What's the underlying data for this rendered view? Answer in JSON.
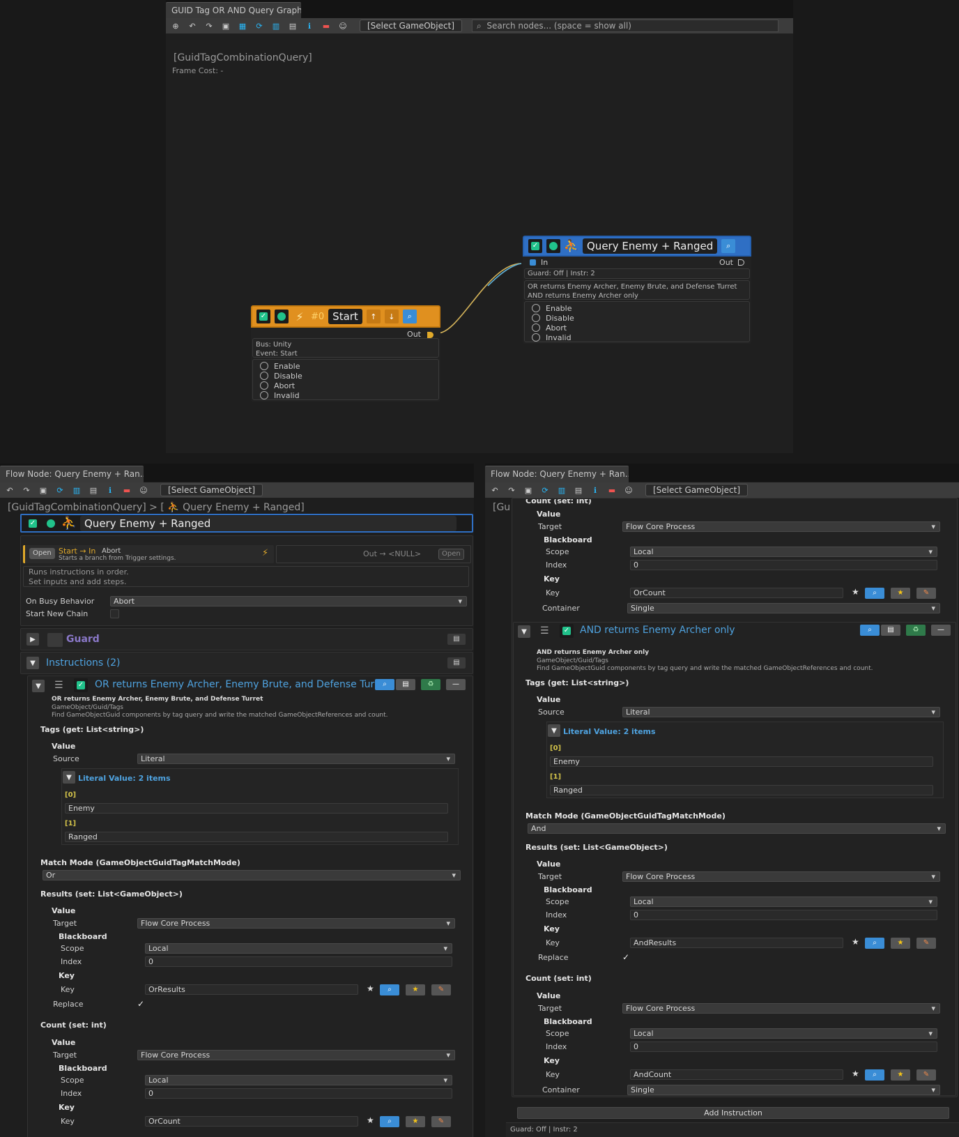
{
  "graph": {
    "tab_title": "GUID Tag OR AND Query Graph",
    "select_gameobject": "[Select GameObject]",
    "search_placeholder": "Search nodes... (space = show all)",
    "query_name": "[GuidTagCombinationQuery]",
    "frame_cost": "Frame Cost: -",
    "start_node": {
      "index": "#0",
      "title": "Start",
      "out_label": "Out",
      "bus": "Bus: Unity",
      "event": "Event: Start",
      "options": [
        "Enable",
        "Disable",
        "Abort",
        "Invalid"
      ]
    },
    "query_node": {
      "title": "Query Enemy + Ranged",
      "in_label": "In",
      "out_label": "Out",
      "guard_info": "Guard: Off | Instr: 2",
      "desc_line1": "OR returns Enemy Archer, Enemy Brute, and Defense Turret",
      "desc_line2": "AND returns Enemy Archer only",
      "options": [
        "Enable",
        "Disable",
        "Abort",
        "Invalid"
      ]
    },
    "colors": {
      "start_accent": "#e0901f",
      "query_accent": "#2f6fc4",
      "check": "#21c28b"
    }
  },
  "left_panel": {
    "tab_title": "Flow Node: Query Enemy + Ran...",
    "select_gameobject": "[Select GameObject]",
    "breadcrumb_root": "[GuidTagCombinationQuery]",
    "breadcrumb_sep": ">",
    "breadcrumb_node": "[ ⛹ Query Enemy + Ranged]",
    "node_title": "Query Enemy + Ranged",
    "open_left": "Open",
    "in_link": "Start → In",
    "in_mode": "Abort",
    "in_desc": "Starts a branch from Trigger settings.",
    "out_link": "Out → <NULL>",
    "open_right": "Open",
    "runs_line1": "Runs instructions in order.",
    "runs_line2": "Set inputs and add steps.",
    "on_busy_label": "On Busy Behavior",
    "on_busy_value": "Abort",
    "start_chain_label": "Start New Chain",
    "guard_label": "Guard",
    "instructions_label": "Instructions (2)",
    "instr": {
      "title": "OR returns Enemy Archer, Enemy Brute, and Defense Turret",
      "sub_title": "OR returns Enemy Archer, Enemy Brute, and Defense Turret",
      "path": "GameObject/Guid/Tags",
      "desc": "Find GameObjectGuid components by tag query and write the matched GameObjectReferences and count.",
      "tags_header": "Tags (get: List<string>)",
      "value_label": "Value",
      "source_label": "Source",
      "source_value": "Literal",
      "literal_header": "Literal Value: 2 items",
      "idx0": "[0]",
      "item0": "Enemy",
      "idx1": "[1]",
      "item1": "Ranged",
      "match_header": "Match Mode (GameObjectGuidTagMatchMode)",
      "match_value": "Or",
      "results_header": "Results (set: List<GameObject>)",
      "r_value": "Value",
      "r_target_label": "Target",
      "r_target": "Flow Core Process",
      "r_bb": "Blackboard",
      "r_scope_label": "Scope",
      "r_scope": "Local",
      "r_index_label": "Index",
      "r_index": "0",
      "r_key_h": "Key",
      "r_key_label": "Key",
      "r_key": "OrResults",
      "r_replace": "Replace",
      "count_header": "Count (set: int)",
      "c_value": "Value",
      "c_target_label": "Target",
      "c_target": "Flow Core Process",
      "c_bb": "Blackboard",
      "c_scope_label": "Scope",
      "c_scope": "Local",
      "c_index_label": "Index",
      "c_index": "0",
      "c_key_h": "Key",
      "c_key_label": "Key",
      "c_key": "OrCount"
    }
  },
  "right_panel": {
    "tab_title": "Flow Node: Query Enemy + Ran...",
    "select_gameobject": "[Select GameObject]",
    "breadcrumb_clip": "[Gu",
    "top_count_header": "Count (set: int)",
    "t_value": "Value",
    "t_target_label": "Target",
    "t_target": "Flow Core Process",
    "t_bb": "Blackboard",
    "t_scope_label": "Scope",
    "t_scope": "Local",
    "t_index_label": "Index",
    "t_index": "0",
    "t_key_h": "Key",
    "t_key_label": "Key",
    "t_key": "OrCount",
    "t_container_label": "Container",
    "t_container": "Single",
    "instr": {
      "title": "AND returns Enemy Archer only",
      "sub_title": "AND returns Enemy Archer only",
      "path": "GameObject/Guid/Tags",
      "desc": "Find GameObjectGuid components by tag query and write the matched GameObjectReferences and count.",
      "tags_header": "Tags (get: List<string>)",
      "value_label": "Value",
      "source_label": "Source",
      "source_value": "Literal",
      "literal_header": "Literal Value: 2 items",
      "idx0": "[0]",
      "item0": "Enemy",
      "idx1": "[1]",
      "item1": "Ranged",
      "match_header": "Match Mode (GameObjectGuidTagMatchMode)",
      "match_value": "And",
      "results_header": "Results (set: List<GameObject>)",
      "r_value": "Value",
      "r_target_label": "Target",
      "r_target": "Flow Core Process",
      "r_bb": "Blackboard",
      "r_scope_label": "Scope",
      "r_scope": "Local",
      "r_index_label": "Index",
      "r_index": "0",
      "r_key_h": "Key",
      "r_key_label": "Key",
      "r_key": "AndResults",
      "r_replace": "Replace",
      "count_header": "Count (set: int)",
      "c_value": "Value",
      "c_target_label": "Target",
      "c_target": "Flow Core Process",
      "c_bb": "Blackboard",
      "c_scope_label": "Scope",
      "c_scope": "Local",
      "c_index_label": "Index",
      "c_index": "0",
      "c_key_h": "Key",
      "c_key_label": "Key",
      "c_key": "AndCount",
      "c_container_label": "Container",
      "c_container": "Single"
    },
    "add_instruction": "Add Instruction",
    "footer": "Guard: Off | Instr: 2"
  },
  "icons": [
    "zoom-icon",
    "undo-icon",
    "redo-icon",
    "frame-icon",
    "layout-icon",
    "refresh-icon",
    "chart-icon",
    "doc-icon",
    "info-icon",
    "camera-icon",
    "avatar-icon",
    "search-icon",
    "lightning-icon",
    "runner-icon",
    "up-arrow-icon",
    "down-arrow-icon",
    "magnify-icon",
    "hamburger-icon",
    "recycle-icon",
    "minus-icon",
    "star-icon",
    "pencil-icon"
  ]
}
